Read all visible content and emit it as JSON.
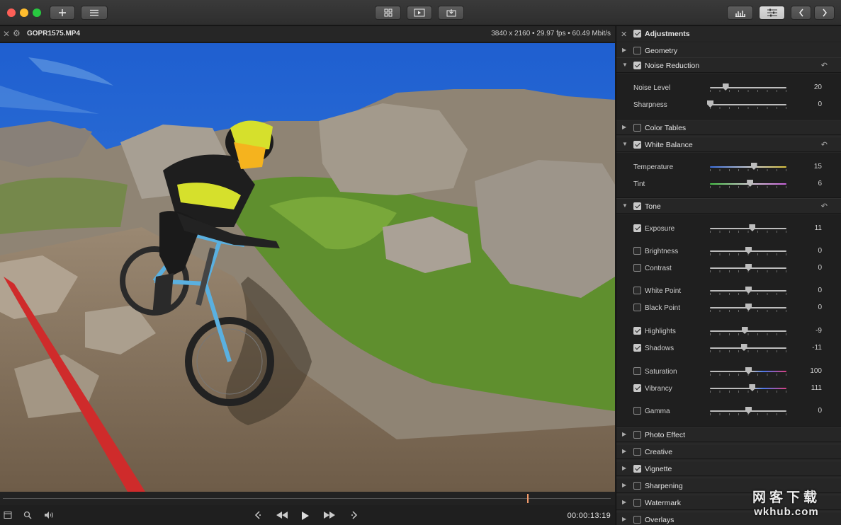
{
  "file": {
    "name": "GOPR1575.MP4",
    "info": "3840 x 2160 • 29.97 fps • 60.49 Mbit/s"
  },
  "transport": {
    "timecode": "00:00:13:19",
    "progress_fraction": 0.862
  },
  "panel": {
    "adjustments": {
      "label": "Adjustments",
      "checked": true
    },
    "sections": [
      {
        "label": "Geometry",
        "checked": false,
        "expanded": false
      },
      {
        "label": "Noise Reduction",
        "checked": true,
        "expanded": true
      },
      {
        "label": "Color Tables",
        "checked": false,
        "expanded": false
      },
      {
        "label": "White Balance",
        "checked": true,
        "expanded": true
      },
      {
        "label": "Tone",
        "checked": true,
        "expanded": true
      },
      {
        "label": "Photo Effect",
        "checked": false,
        "expanded": false
      },
      {
        "label": "Creative",
        "checked": false,
        "expanded": false
      },
      {
        "label": "Vignette",
        "checked": true,
        "expanded": false
      },
      {
        "label": "Sharpening",
        "checked": false,
        "expanded": false
      },
      {
        "label": "Watermark",
        "checked": false,
        "expanded": false
      },
      {
        "label": "Overlays",
        "checked": false,
        "expanded": false
      }
    ],
    "noise": [
      {
        "label": "Noise Level",
        "value": "20",
        "level": 0.2
      },
      {
        "label": "Sharpness",
        "value": "0",
        "level": 0.0
      }
    ],
    "white_balance": [
      {
        "label": "Temperature",
        "value": "15",
        "level": 0.57
      },
      {
        "label": "Tint",
        "value": "6",
        "level": 0.52
      }
    ],
    "tone": [
      {
        "label": "Exposure",
        "value": "11",
        "level": 0.55,
        "checked": true
      },
      {
        "label": "Brightness",
        "value": "0",
        "level": 0.5,
        "checked": false
      },
      {
        "label": "Contrast",
        "value": "0",
        "level": 0.5,
        "checked": false
      },
      {
        "label": "White Point",
        "value": "0",
        "level": 0.5,
        "checked": false
      },
      {
        "label": "Black Point",
        "value": "0",
        "level": 0.5,
        "checked": false
      },
      {
        "label": "Highlights",
        "value": "-9",
        "level": 0.45,
        "checked": true
      },
      {
        "label": "Shadows",
        "value": "-11",
        "level": 0.44,
        "checked": true
      },
      {
        "label": "Saturation",
        "value": "100",
        "level": 0.5,
        "checked": false
      },
      {
        "label": "Vibrancy",
        "value": "111",
        "level": 0.55,
        "checked": true
      },
      {
        "label": "Gamma",
        "value": "0",
        "level": 0.5,
        "checked": false
      }
    ]
  },
  "watermark": {
    "line1": "网客下载",
    "line2": "wkhub.com"
  },
  "icons": {
    "toolbar": [
      "add-icon",
      "menu-icon",
      "grid-view-icon",
      "play-view-icon",
      "export-icon",
      "histogram-icon",
      "adjustments-icon",
      "back-icon",
      "forward-icon"
    ],
    "transport": [
      "sidebar-icon",
      "zoom-icon",
      "volume-icon",
      "prev-marker-icon",
      "rewind-icon",
      "play-icon",
      "fast-forward-icon",
      "next-marker-icon"
    ]
  }
}
